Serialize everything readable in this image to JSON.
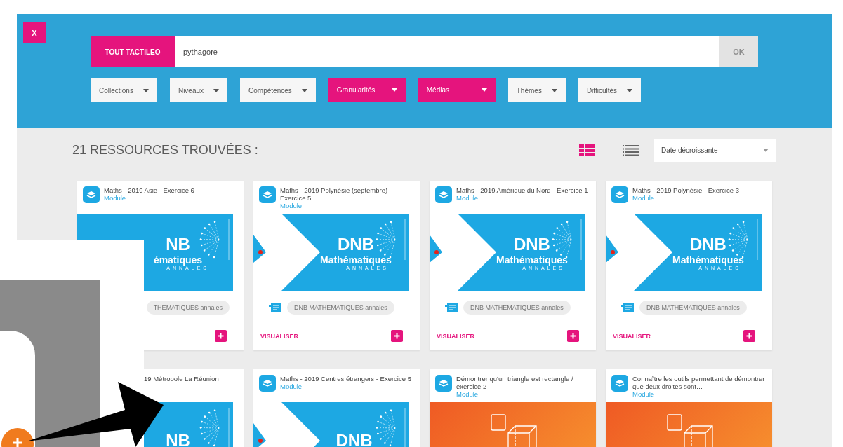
{
  "close_button": "X",
  "search": {
    "scope_button": "TOUT TACTILEO",
    "value": "pythagore",
    "submit_button": "OK"
  },
  "filters": [
    {
      "label": "Collections",
      "active": false
    },
    {
      "label": "Niveaux",
      "active": false
    },
    {
      "label": "Compétences",
      "active": false
    },
    {
      "label": "Granularités",
      "active": true
    },
    {
      "label": "Médias",
      "active": true
    },
    {
      "label": "Thèmes",
      "active": false
    },
    {
      "label": "Difficultés",
      "active": false
    }
  ],
  "results_heading": "21 RESSOURCES TROUVÉES :",
  "views": [
    {
      "kind": "grid",
      "selected": true
    },
    {
      "kind": "list",
      "selected": false
    }
  ],
  "sort": {
    "value": "Date décroissante"
  },
  "cards": [
    {
      "title": "Maths - 2019 Asie - Exercice 6",
      "type": "Module",
      "thumb": {
        "kind": "dnb",
        "title": "NB",
        "subtitle": "ématiques",
        "caption": "ANNALES"
      },
      "tag": "THEMATIQUES annales",
      "tag_icon": false
    },
    {
      "title": "Maths - 2019 Polynésie (septembre) - Exercice 5",
      "type": "Module",
      "thumb": {
        "kind": "dnb",
        "title": "DNB",
        "subtitle": "Mathématiques",
        "caption": "ANNALES"
      },
      "tag": "DNB MATHEMATIQUES annales",
      "tag_icon": true,
      "action": "VISUALISER"
    },
    {
      "title": "Maths - 2019 Amérique du Nord - Exercice 1",
      "type": "Module",
      "thumb": {
        "kind": "dnb",
        "title": "DNB",
        "subtitle": "Mathématiques",
        "caption": "ANNALES"
      },
      "tag": "DNB MATHEMATIQUES annales",
      "tag_icon": true,
      "action": "VISUALISER"
    },
    {
      "title": "Maths - 2019 Polynésie - Exercice 3",
      "type": "Module",
      "thumb": {
        "kind": "dnb",
        "title": "DNB",
        "subtitle": "Mathématiques",
        "caption": "ANNALES"
      },
      "tag": "DNB MATHEMATIQUES annales",
      "tag_icon": true,
      "action": "VISUALISER"
    },
    {
      "title": "19 Métropole La Réunion",
      "thumb": {
        "kind": "dnb",
        "title": "NB"
      }
    },
    {
      "title": "Maths - 2019 Centres étrangers - Exercice 5",
      "type": "Module",
      "thumb": {
        "kind": "dnb",
        "title": "DNB"
      }
    },
    {
      "title": "Démontrer qu'un triangle est rectangle / exercice 2",
      "type": "Module",
      "thumb": {
        "kind": "geometry"
      }
    },
    {
      "title": "Connaître les outils permettant de démontrer que deux droites sont…",
      "type": "Module",
      "thumb": {
        "kind": "geometry"
      }
    }
  ]
}
